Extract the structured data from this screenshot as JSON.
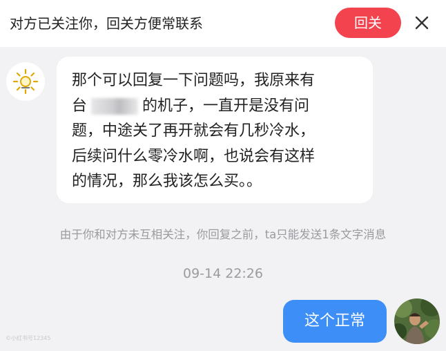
{
  "header": {
    "notice": "对方已关注你，回关方便常联系",
    "follow_back_label": "回关",
    "close_icon": "close-icon",
    "follow_button_color": "#f2434f"
  },
  "conversation": {
    "incoming": {
      "avatar_icon": "sun-icon",
      "lines": [
        "那个可以回复一下问题吗，我原来有",
        "的机子，一直开是没有问",
        "题，中途关了再开就会有几秒冷水，",
        "后续问什么零冷水啊，也说会有这样",
        "的情况，那么我该怎么买。。"
      ],
      "line2_prefix": "台"
    },
    "system_notice": "由于你和对方未互相关注，你回复之前，ta只能发送1条文字消息",
    "timestamp": "09-14 22:26",
    "outgoing": {
      "text": "这个正常",
      "bubble_color": "#3d8ef7"
    }
  },
  "watermark": "©小红书号12345"
}
